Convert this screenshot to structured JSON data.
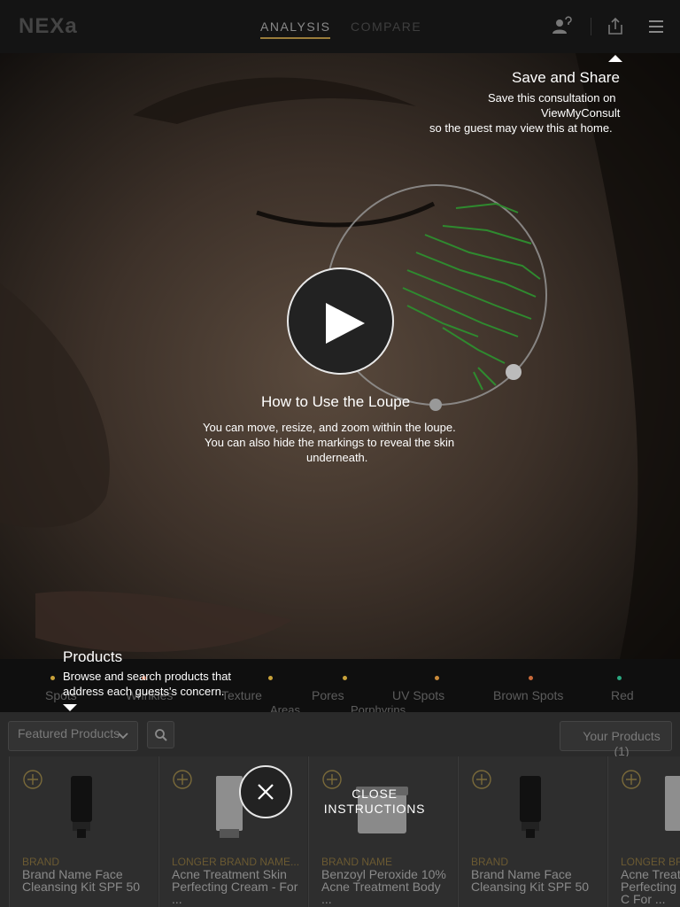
{
  "topbar": {
    "logo": "NEXa",
    "tabs": [
      {
        "label": "ANALYSIS",
        "active": true
      },
      {
        "label": "COMPARE",
        "active": false
      }
    ],
    "icons": [
      "person-help-icon",
      "share-icon",
      "menu-icon"
    ]
  },
  "tips": {
    "save_share": {
      "title": "Save and Share",
      "line1": "Save this consultation on",
      "line2": "ViewMyConsult",
      "line3": "so the guest may view this at home."
    },
    "loupe": {
      "title": "How to Use the Loupe",
      "line1": "You can move, resize, and zoom within the loupe.",
      "line2": "You can also hide the markings to reveal the skin",
      "line3": "underneath."
    },
    "products": {
      "title": "Products",
      "line1": "Browse and search products that",
      "line2": "address each guests's concern."
    }
  },
  "concerns": [
    {
      "label": "Spots",
      "color": "#c9a23a"
    },
    {
      "label": "Wrinkles",
      "color": "#b35a3a"
    },
    {
      "label": "Texture",
      "color": "#c9a23a"
    },
    {
      "label": "Pores",
      "color": "#c9a23a"
    },
    {
      "label": "UV Spots",
      "color": "#c98a3a"
    },
    {
      "label": "Brown Spots",
      "color": "#c96a3a"
    },
    {
      "label": "Red",
      "color": "#2aa880"
    },
    {
      "label": "Areas",
      "color": ""
    },
    {
      "label": "Porphyrins",
      "color": ""
    }
  ],
  "products": {
    "filter_label": "Featured Products",
    "your_products": "Your Products (1)",
    "items": [
      {
        "brand": "BRAND",
        "name": "Brand Name Face Cleansing Kit SPF 50",
        "image": "tube-icon"
      },
      {
        "brand": "LONGER BRAND NAME...",
        "name": "Acne Treatment Skin Perfecting Cream - For ...",
        "image": "bottle-icon"
      },
      {
        "brand": "BRAND NAME",
        "name": "Benzoyl Peroxide 10% Acne Treatment Body ...",
        "image": "jar-icon"
      },
      {
        "brand": "BRAND",
        "name": "Brand Name Face Cleansing Kit SPF 50",
        "image": "tube-icon"
      },
      {
        "brand": "LONGER BR",
        "name": "Acne Treat Perfecting C For ...",
        "image": "bottle-icon"
      }
    ]
  },
  "close": {
    "label": "CLOSE INSTRUCTIONS"
  },
  "colors": {
    "accent": "#9a7c3a",
    "loupe_marks": "#2f8a2f"
  }
}
